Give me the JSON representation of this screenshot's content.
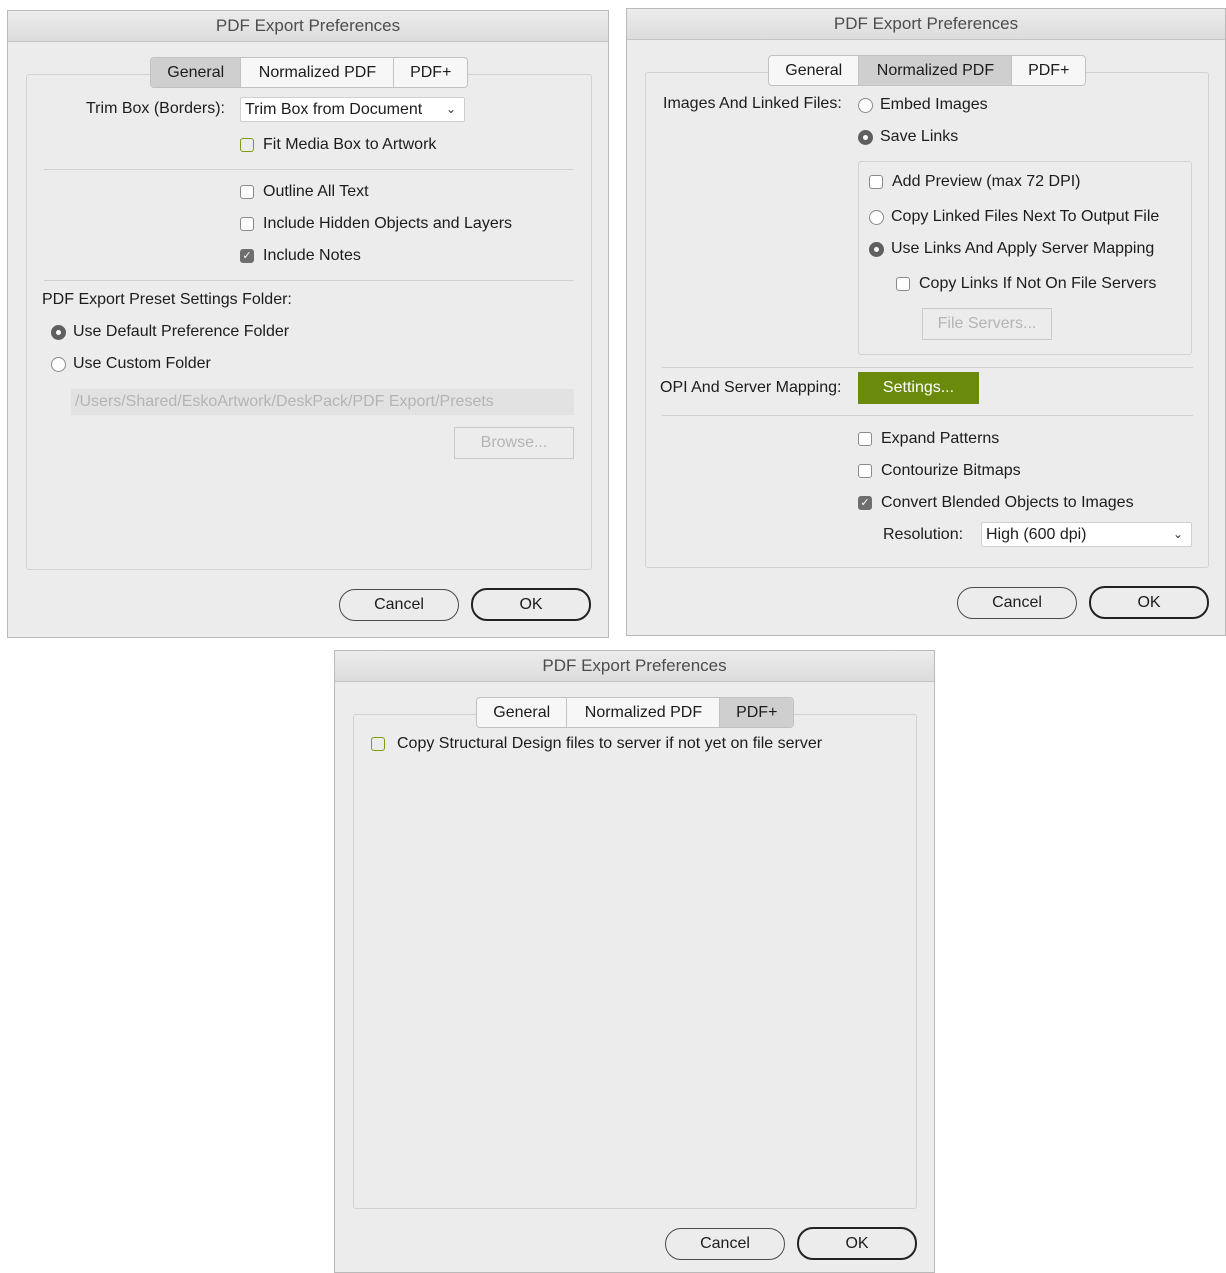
{
  "dialog_title": "PDF Export Preferences",
  "tabs": [
    "General",
    "Normalized PDF",
    "PDF+"
  ],
  "buttons": {
    "cancel": "Cancel",
    "ok": "OK"
  },
  "general": {
    "trim_box_label": "Trim Box (Borders):",
    "trim_box_value": "Trim Box from Document",
    "fit_media_box": {
      "label": "Fit Media Box to Artwork",
      "checked": false
    },
    "outline_all_text": {
      "label": "Outline All Text",
      "checked": false
    },
    "include_hidden": {
      "label": "Include Hidden Objects and Layers",
      "checked": false
    },
    "include_notes": {
      "label": "Include Notes",
      "checked": true
    },
    "preset_folder_label": "PDF Export Preset Settings Folder:",
    "use_default_folder": {
      "label": "Use Default Preference Folder",
      "selected": true
    },
    "use_custom_folder": {
      "label": "Use Custom Folder",
      "selected": false
    },
    "folder_path": "/Users/Shared/EskoArtwork/DeskPack/PDF Export/Presets",
    "browse_label": "Browse..."
  },
  "normalized": {
    "images_label": "Images And Linked Files:",
    "embed_images": {
      "label": "Embed Images",
      "selected": false
    },
    "save_links": {
      "label": "Save Links",
      "selected": true
    },
    "add_preview": {
      "label": "Add Preview (max 72 DPI)",
      "checked": false
    },
    "copy_linked_files": {
      "label": "Copy Linked Files Next To Output File",
      "selected": false
    },
    "use_links_server_mapping": {
      "label": "Use Links And Apply Server Mapping",
      "selected": true
    },
    "copy_links_if_not": {
      "label": "Copy Links If Not On File Servers",
      "checked": false
    },
    "file_servers_label": "File Servers...",
    "opi_label": "OPI And Server Mapping:",
    "settings_label": "Settings...",
    "expand_patterns": {
      "label": "Expand Patterns",
      "checked": false
    },
    "contourize_bitmaps": {
      "label": "Contourize Bitmaps",
      "checked": false
    },
    "convert_blended": {
      "label": "Convert Blended Objects to Images",
      "checked": true
    },
    "resolution_label": "Resolution:",
    "resolution_value": "High (600 dpi)"
  },
  "pdfplus": {
    "copy_structural": {
      "label": "Copy Structural Design files to server if not yet on file server",
      "checked": false
    }
  },
  "colors": {
    "accent_green": "#6a8a0b",
    "checkbox_green_border": "#7c9b13"
  }
}
